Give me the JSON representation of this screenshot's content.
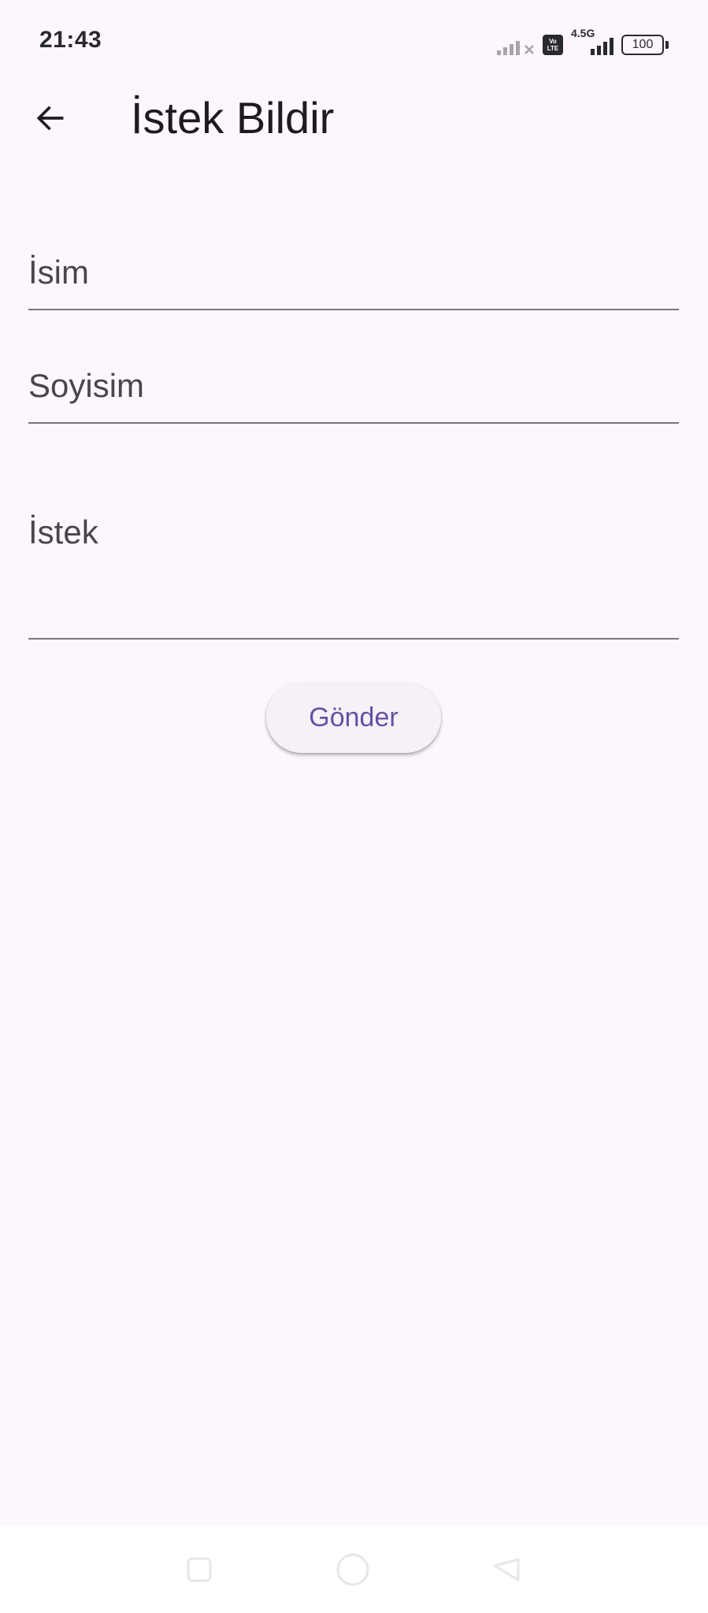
{
  "status_bar": {
    "time": "21:43",
    "network_type": "4.5G",
    "volte_top": "Vo",
    "volte_bottom": "LTE",
    "battery_level": "100",
    "icons": [
      "signal-off-icon",
      "volte-icon",
      "signal-icon",
      "battery-icon"
    ]
  },
  "app_bar": {
    "title": "İstek Bildir",
    "back_icon": "arrow-left-icon"
  },
  "form": {
    "name": {
      "placeholder": "İsim",
      "value": ""
    },
    "surname": {
      "placeholder": "Soyisim",
      "value": ""
    },
    "request": {
      "placeholder": "İstek",
      "value": ""
    },
    "submit_label": "Gönder"
  },
  "nav_bar": {
    "icons": [
      "square-recent-icon",
      "circle-home-icon",
      "triangle-back-icon"
    ]
  },
  "colors": {
    "background": "#fdf7fd",
    "primary": "#6750a4",
    "text": "#1d1b20",
    "field_text": "#49454f",
    "underline": "#79747e",
    "button_surface": "#f6f1f7"
  }
}
